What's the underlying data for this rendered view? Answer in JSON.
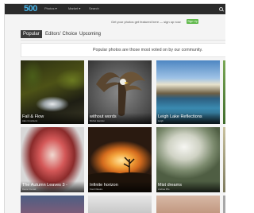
{
  "topbar": {
    "logo": "500",
    "nav": [
      "Photos ▾",
      "Market ▾",
      "Search"
    ],
    "search_icon": "search-icon"
  },
  "promo": {
    "text": "Get your photos get featured here — sign up now",
    "button": "Sign Up"
  },
  "tabs": [
    "Popular",
    "Editors' Choice",
    "Upcoming"
  ],
  "subtitle": "Popular photos are those most voted on by our community.",
  "photos": [
    {
      "title": "Fall & Flow",
      "author": "Alan Crowhurst"
    },
    {
      "title": "without words",
      "author": "Michel Gierdov"
    },
    {
      "title": "Leigh Lake Reflections",
      "author": "Leigh"
    },
    {
      "title": "",
      "author": ""
    },
    {
      "title": "The Autumn Leaves 3 -",
      "author": "Daniel Duniak"
    },
    {
      "title": "Infinite horizon",
      "author": "Fred Oliveira"
    },
    {
      "title": "Mist dreams",
      "author": "Andrea Pilo"
    },
    {
      "title": "",
      "author": ""
    }
  ]
}
